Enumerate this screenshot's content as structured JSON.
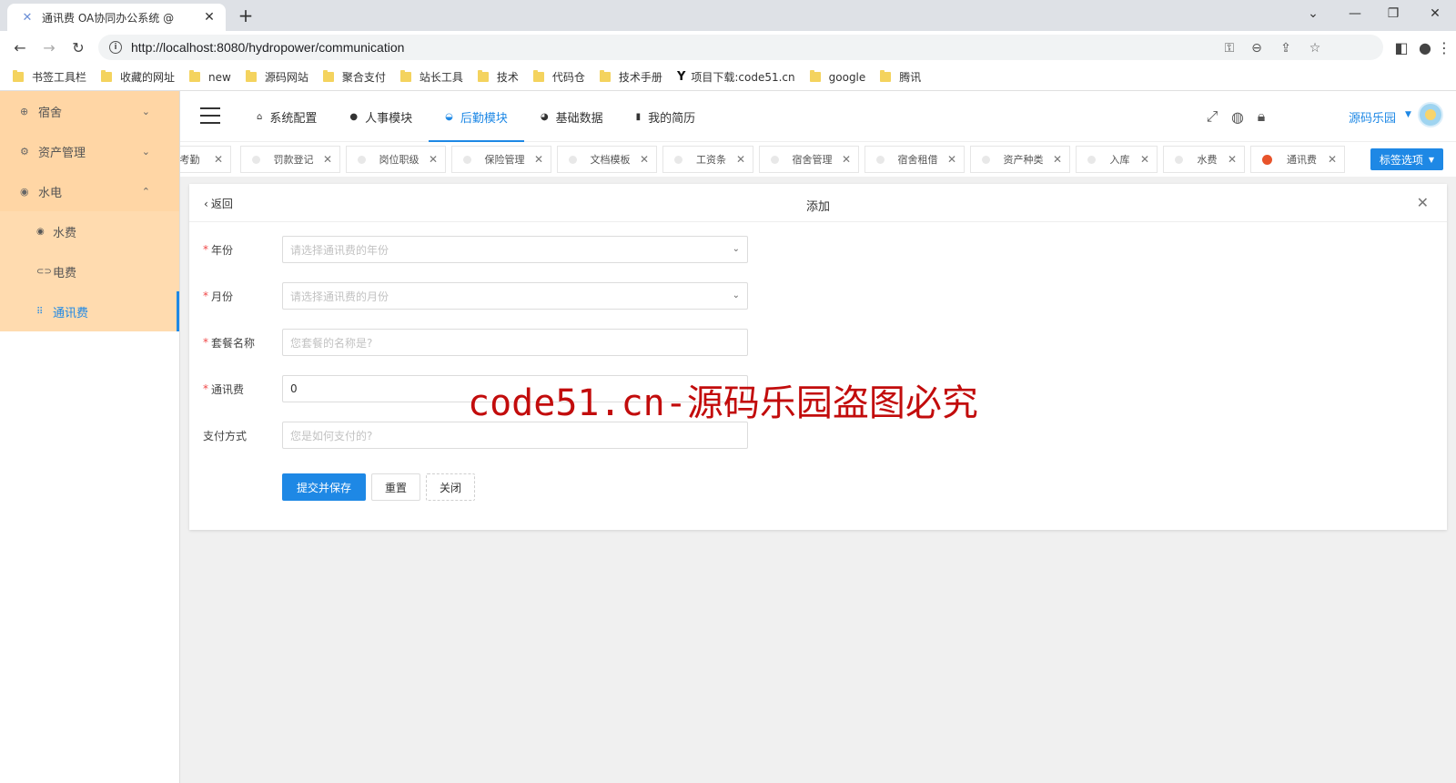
{
  "browser": {
    "tab_title": "通讯费 OA协同办公系统 @",
    "url": "http://localhost:8080/hydropower/communication",
    "bookmarks": [
      "书签工具栏",
      "收藏的网址",
      "new",
      "源码网站",
      "聚合支付",
      "站长工具",
      "技术",
      "代码仓",
      "技术手册",
      "项目下载:code51.cn",
      "google",
      "腾讯"
    ]
  },
  "sidebar": {
    "items": [
      {
        "label": "宿舍",
        "icon": "globe-icon",
        "expanded": false
      },
      {
        "label": "资产管理",
        "icon": "gear-icon",
        "expanded": false
      },
      {
        "label": "水电",
        "icon": "target-icon",
        "expanded": true
      }
    ],
    "subitems": [
      {
        "label": "水费",
        "icon": "radio-icon"
      },
      {
        "label": "电费",
        "icon": "link-icon"
      },
      {
        "label": "通讯费",
        "icon": "grid-icon",
        "active": true
      }
    ]
  },
  "topnav": {
    "items": [
      {
        "label": "系统配置",
        "icon": "home-icon"
      },
      {
        "label": "人事模块",
        "icon": "leaf-icon"
      },
      {
        "label": "后勤模块",
        "icon": "basket-icon",
        "active": true
      },
      {
        "label": "基础数据",
        "icon": "piechart-icon"
      },
      {
        "label": "我的简历",
        "icon": "book-icon"
      }
    ],
    "user_name": "源码乐园"
  },
  "pagetabs": {
    "items": [
      "打考勤",
      "罚款登记",
      "岗位职级",
      "保险管理",
      "文档模板",
      "工资条",
      "宿舍管理",
      "宿舍租借",
      "资产种类",
      "入库",
      "水费",
      "通讯费"
    ],
    "options_label": "标签选项"
  },
  "form": {
    "back_label": "返回",
    "title": "添加",
    "fields": [
      {
        "label": "年份",
        "required": true,
        "type": "select",
        "placeholder": "请选择通讯费的年份",
        "value": ""
      },
      {
        "label": "月份",
        "required": true,
        "type": "select",
        "placeholder": "请选择通讯费的月份",
        "value": ""
      },
      {
        "label": "套餐名称",
        "required": true,
        "type": "text",
        "placeholder": "您套餐的名称是?",
        "value": ""
      },
      {
        "label": "通讯费",
        "required": true,
        "type": "text",
        "placeholder": "",
        "value": "0"
      },
      {
        "label": "支付方式",
        "required": false,
        "type": "text",
        "placeholder": "您是如何支付的?",
        "value": ""
      }
    ],
    "buttons": {
      "submit": "提交并保存",
      "reset": "重置",
      "close": "关闭"
    }
  },
  "watermark": "code51.cn-源码乐园盗图必究"
}
